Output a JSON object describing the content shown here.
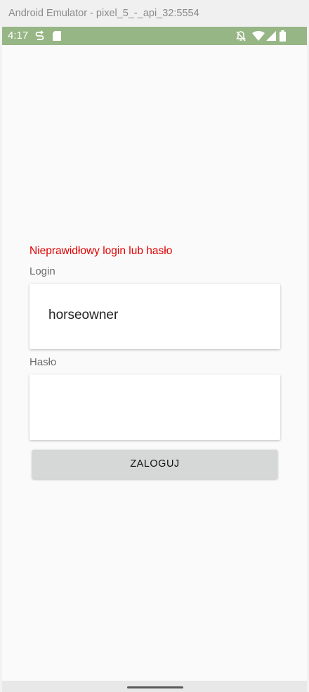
{
  "window": {
    "title": "Android Emulator - pixel_5_-_api_32:5554"
  },
  "status_bar": {
    "time": "4:17",
    "background": "#97b685",
    "icons_left": [
      "sync-icon",
      "sd-card-icon"
    ],
    "icons_right": [
      "notifications-off-icon",
      "wifi-icon",
      "signal-icon",
      "battery-icon"
    ]
  },
  "login_form": {
    "error_message": "Nieprawidłowy login lub hasło",
    "error_color": "#e00000",
    "login_label": "Login",
    "login_value": "horseowner",
    "password_label": "Hasło",
    "password_value": "",
    "submit_label": "ZALOGUJ"
  }
}
